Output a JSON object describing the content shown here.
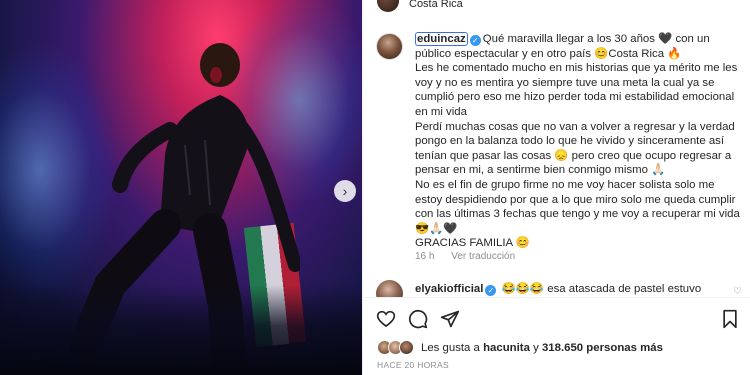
{
  "post": {
    "location": "Costa Rica",
    "caption": {
      "username": "eduincaz",
      "paragraphs": [
        "Qué maravilla llegar a los 30 años 🖤 con un público espectacular y en otro país 😊Costa Rica 🔥",
        "Les he comentado mucho en mis historias que ya mérito me les voy y no es mentira yo siempre tuve una meta la cual ya se cumplió pero eso me hizo perder toda mi estabilidad emocional en mi vida",
        "Perdí muchas cosas que no van a volver a regresar y la verdad pongo en la balanza todo lo que he vivido y sinceramente así tenían que pasar las cosas 😞 pero creo que ocupo regresar a pensar en mi, a sentirme bien conmigo mismo 🙏🏻",
        "No es el fin de grupo firme no me voy hacer solista solo me estoy despidiendo por que a lo que miro solo me queda cumplir con las últimas 3 fechas que tengo y me voy a recuperar mi vida 😎🙏🏻🖤",
        "GRACIAS FAMILIA 😊"
      ]
    },
    "caption_meta": {
      "age": "16 h",
      "translation_label": "Ver traducción"
    },
    "comment": {
      "username": "elyakiofficial",
      "text": "😂😂😂 esa atascada de pastel estuvo"
    },
    "likes": {
      "prefix": "Les gusta a",
      "user": "hacunita",
      "connector": "y",
      "others": "318.650 personas más"
    },
    "posted_ago": "HACE 20 HORAS"
  },
  "icons": {
    "like": "heart-icon",
    "comment": "comment-icon",
    "share": "share-icon",
    "save": "bookmark-icon",
    "carousel": "chevron-right-icon",
    "verified": "verified-badge-icon"
  },
  "colors": {
    "verified_blue": "#3897f0",
    "text": "#262626",
    "secondary_text": "#8e8e8e"
  }
}
